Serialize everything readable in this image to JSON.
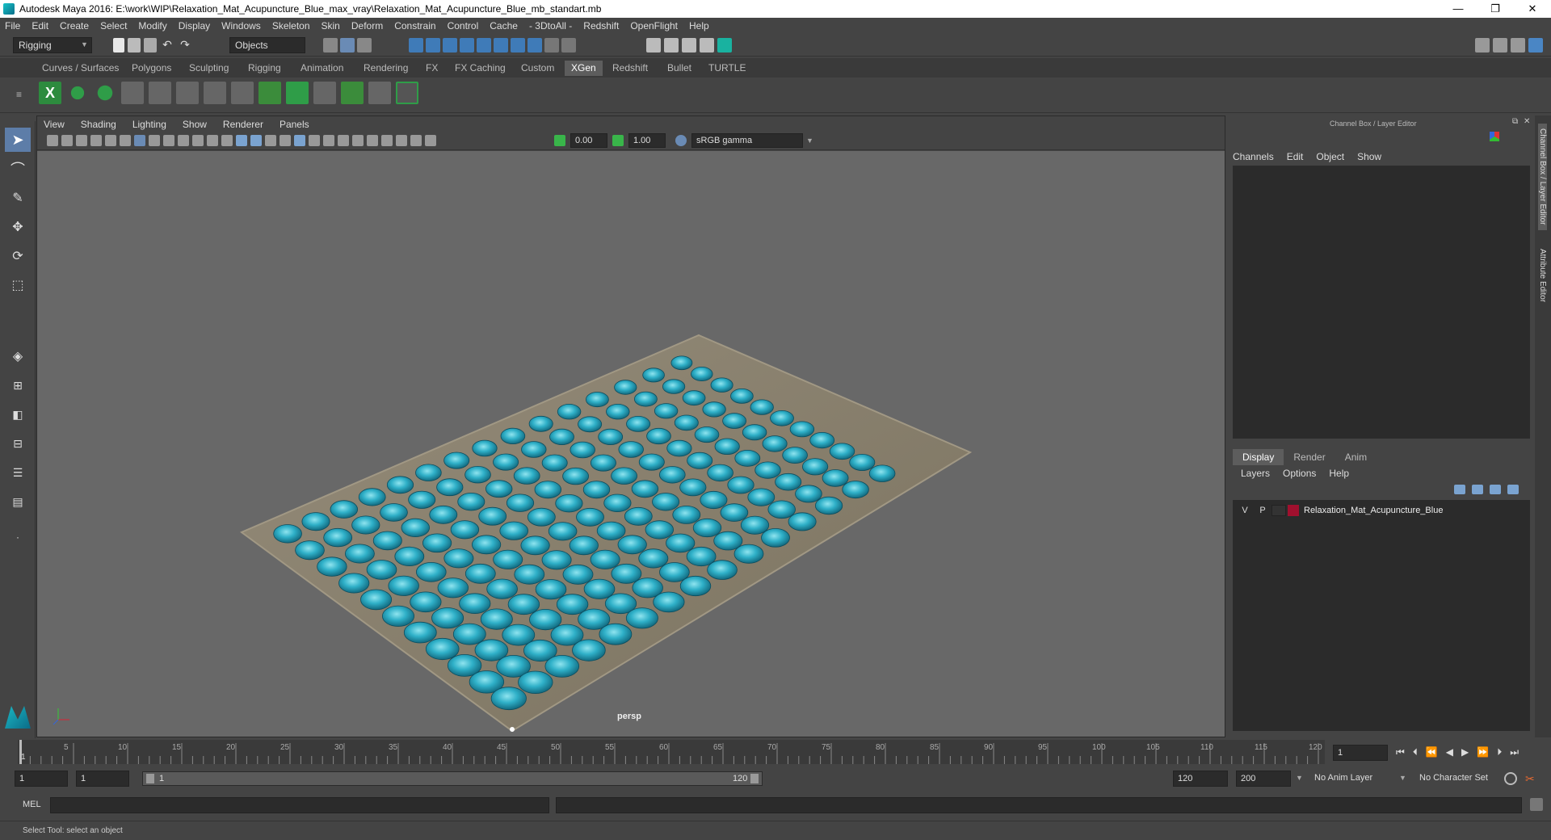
{
  "window": {
    "title": "Autodesk Maya 2016: E:\\work\\WIP\\Relaxation_Mat_Acupuncture_Blue_max_vray\\Relaxation_Mat_Acupuncture_Blue_mb_standart.mb",
    "minimize": "—",
    "restore": "❐",
    "close": "✕"
  },
  "menus": [
    "File",
    "Edit",
    "Create",
    "Select",
    "Modify",
    "Display",
    "Windows",
    "Skeleton",
    "Skin",
    "Deform",
    "Constrain",
    "Control",
    "Cache",
    "- 3DtoAll -",
    "Redshift",
    "OpenFlight",
    "Help"
  ],
  "status": {
    "mode": "Rigging",
    "selection_mode": "Objects"
  },
  "shelf_tabs": [
    "Curves / Surfaces",
    "Polygons",
    "Sculpting",
    "Rigging",
    "Animation",
    "Rendering",
    "FX",
    "FX Caching",
    "Custom",
    "XGen",
    "Redshift",
    "Bullet",
    "TURTLE"
  ],
  "active_shelf_tab": "XGen",
  "viewport": {
    "menus": [
      "View",
      "Shading",
      "Lighting",
      "Show",
      "Renderer",
      "Panels"
    ],
    "near_value": "0.00",
    "far_value": "1.00",
    "color_space": "sRGB gamma",
    "camera_label": "persp"
  },
  "channel_box": {
    "title": "Channel Box / Layer Editor",
    "menus": [
      "Channels",
      "Edit",
      "Object",
      "Show"
    ]
  },
  "layer_editor": {
    "tabs": [
      "Display",
      "Render",
      "Anim"
    ],
    "active_tab": "Display",
    "menus": [
      "Layers",
      "Options",
      "Help"
    ],
    "layers": [
      {
        "visible": "V",
        "playback": "P",
        "color": "#a0102e",
        "name": "Relaxation_Mat_Acupuncture_Blue"
      }
    ]
  },
  "side_tabs": [
    "Channel Box / Layer Editor",
    "Attribute Editor"
  ],
  "timeline": {
    "ticks": [
      "5",
      "10",
      "15",
      "20",
      "25",
      "30",
      "35",
      "40",
      "45",
      "50",
      "55",
      "60",
      "65",
      "70",
      "75",
      "80",
      "85",
      "90",
      "95",
      "100",
      "105",
      "110",
      "115",
      "120"
    ],
    "start_marker": "1",
    "current_frame": "1"
  },
  "range": {
    "start_time": "1",
    "playback_start": "1",
    "slider_start": "1",
    "slider_end": "120",
    "playback_end": "120",
    "end_time": "200",
    "anim_layer": "No Anim Layer",
    "character_set": "No Character Set"
  },
  "command_line": {
    "label": "MEL"
  },
  "help_line": "Select Tool: select an object",
  "colors": {
    "accent_cyan": "#1aa9bf",
    "mat": "#8a8170",
    "viewport_bg": "#686868"
  }
}
